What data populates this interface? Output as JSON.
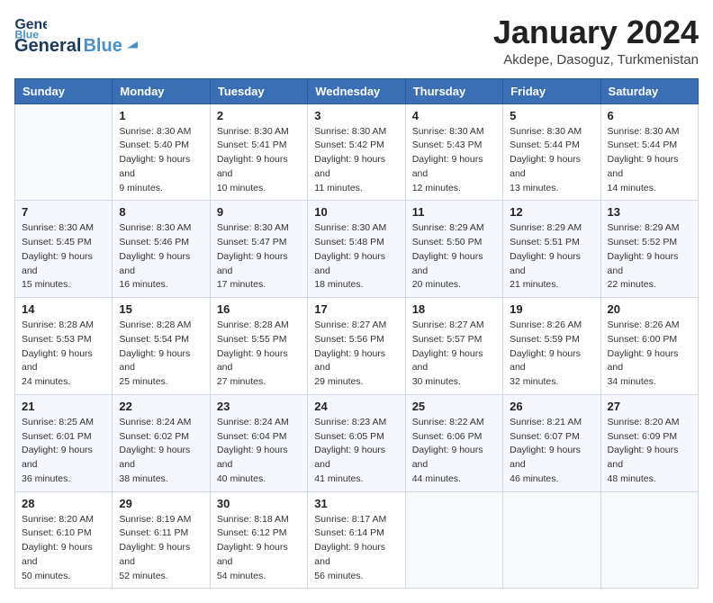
{
  "header": {
    "logo": {
      "general": "General",
      "blue": "Blue"
    },
    "title": "January 2024",
    "location": "Akdepe, Dasoguz, Turkmenistan"
  },
  "days_of_week": [
    "Sunday",
    "Monday",
    "Tuesday",
    "Wednesday",
    "Thursday",
    "Friday",
    "Saturday"
  ],
  "weeks": [
    [
      {
        "day": "",
        "sunrise": "",
        "sunset": "",
        "daylight": ""
      },
      {
        "day": "1",
        "sunrise": "Sunrise: 8:30 AM",
        "sunset": "Sunset: 5:40 PM",
        "daylight": "Daylight: 9 hours and 9 minutes."
      },
      {
        "day": "2",
        "sunrise": "Sunrise: 8:30 AM",
        "sunset": "Sunset: 5:41 PM",
        "daylight": "Daylight: 9 hours and 10 minutes."
      },
      {
        "day": "3",
        "sunrise": "Sunrise: 8:30 AM",
        "sunset": "Sunset: 5:42 PM",
        "daylight": "Daylight: 9 hours and 11 minutes."
      },
      {
        "day": "4",
        "sunrise": "Sunrise: 8:30 AM",
        "sunset": "Sunset: 5:43 PM",
        "daylight": "Daylight: 9 hours and 12 minutes."
      },
      {
        "day": "5",
        "sunrise": "Sunrise: 8:30 AM",
        "sunset": "Sunset: 5:44 PM",
        "daylight": "Daylight: 9 hours and 13 minutes."
      },
      {
        "day": "6",
        "sunrise": "Sunrise: 8:30 AM",
        "sunset": "Sunset: 5:44 PM",
        "daylight": "Daylight: 9 hours and 14 minutes."
      }
    ],
    [
      {
        "day": "7",
        "sunrise": "Sunrise: 8:30 AM",
        "sunset": "Sunset: 5:45 PM",
        "daylight": "Daylight: 9 hours and 15 minutes."
      },
      {
        "day": "8",
        "sunrise": "Sunrise: 8:30 AM",
        "sunset": "Sunset: 5:46 PM",
        "daylight": "Daylight: 9 hours and 16 minutes."
      },
      {
        "day": "9",
        "sunrise": "Sunrise: 8:30 AM",
        "sunset": "Sunset: 5:47 PM",
        "daylight": "Daylight: 9 hours and 17 minutes."
      },
      {
        "day": "10",
        "sunrise": "Sunrise: 8:30 AM",
        "sunset": "Sunset: 5:48 PM",
        "daylight": "Daylight: 9 hours and 18 minutes."
      },
      {
        "day": "11",
        "sunrise": "Sunrise: 8:29 AM",
        "sunset": "Sunset: 5:50 PM",
        "daylight": "Daylight: 9 hours and 20 minutes."
      },
      {
        "day": "12",
        "sunrise": "Sunrise: 8:29 AM",
        "sunset": "Sunset: 5:51 PM",
        "daylight": "Daylight: 9 hours and 21 minutes."
      },
      {
        "day": "13",
        "sunrise": "Sunrise: 8:29 AM",
        "sunset": "Sunset: 5:52 PM",
        "daylight": "Daylight: 9 hours and 22 minutes."
      }
    ],
    [
      {
        "day": "14",
        "sunrise": "Sunrise: 8:28 AM",
        "sunset": "Sunset: 5:53 PM",
        "daylight": "Daylight: 9 hours and 24 minutes."
      },
      {
        "day": "15",
        "sunrise": "Sunrise: 8:28 AM",
        "sunset": "Sunset: 5:54 PM",
        "daylight": "Daylight: 9 hours and 25 minutes."
      },
      {
        "day": "16",
        "sunrise": "Sunrise: 8:28 AM",
        "sunset": "Sunset: 5:55 PM",
        "daylight": "Daylight: 9 hours and 27 minutes."
      },
      {
        "day": "17",
        "sunrise": "Sunrise: 8:27 AM",
        "sunset": "Sunset: 5:56 PM",
        "daylight": "Daylight: 9 hours and 29 minutes."
      },
      {
        "day": "18",
        "sunrise": "Sunrise: 8:27 AM",
        "sunset": "Sunset: 5:57 PM",
        "daylight": "Daylight: 9 hours and 30 minutes."
      },
      {
        "day": "19",
        "sunrise": "Sunrise: 8:26 AM",
        "sunset": "Sunset: 5:59 PM",
        "daylight": "Daylight: 9 hours and 32 minutes."
      },
      {
        "day": "20",
        "sunrise": "Sunrise: 8:26 AM",
        "sunset": "Sunset: 6:00 PM",
        "daylight": "Daylight: 9 hours and 34 minutes."
      }
    ],
    [
      {
        "day": "21",
        "sunrise": "Sunrise: 8:25 AM",
        "sunset": "Sunset: 6:01 PM",
        "daylight": "Daylight: 9 hours and 36 minutes."
      },
      {
        "day": "22",
        "sunrise": "Sunrise: 8:24 AM",
        "sunset": "Sunset: 6:02 PM",
        "daylight": "Daylight: 9 hours and 38 minutes."
      },
      {
        "day": "23",
        "sunrise": "Sunrise: 8:24 AM",
        "sunset": "Sunset: 6:04 PM",
        "daylight": "Daylight: 9 hours and 40 minutes."
      },
      {
        "day": "24",
        "sunrise": "Sunrise: 8:23 AM",
        "sunset": "Sunset: 6:05 PM",
        "daylight": "Daylight: 9 hours and 41 minutes."
      },
      {
        "day": "25",
        "sunrise": "Sunrise: 8:22 AM",
        "sunset": "Sunset: 6:06 PM",
        "daylight": "Daylight: 9 hours and 44 minutes."
      },
      {
        "day": "26",
        "sunrise": "Sunrise: 8:21 AM",
        "sunset": "Sunset: 6:07 PM",
        "daylight": "Daylight: 9 hours and 46 minutes."
      },
      {
        "day": "27",
        "sunrise": "Sunrise: 8:20 AM",
        "sunset": "Sunset: 6:09 PM",
        "daylight": "Daylight: 9 hours and 48 minutes."
      }
    ],
    [
      {
        "day": "28",
        "sunrise": "Sunrise: 8:20 AM",
        "sunset": "Sunset: 6:10 PM",
        "daylight": "Daylight: 9 hours and 50 minutes."
      },
      {
        "day": "29",
        "sunrise": "Sunrise: 8:19 AM",
        "sunset": "Sunset: 6:11 PM",
        "daylight": "Daylight: 9 hours and 52 minutes."
      },
      {
        "day": "30",
        "sunrise": "Sunrise: 8:18 AM",
        "sunset": "Sunset: 6:12 PM",
        "daylight": "Daylight: 9 hours and 54 minutes."
      },
      {
        "day": "31",
        "sunrise": "Sunrise: 8:17 AM",
        "sunset": "Sunset: 6:14 PM",
        "daylight": "Daylight: 9 hours and 56 minutes."
      },
      {
        "day": "",
        "sunrise": "",
        "sunset": "",
        "daylight": ""
      },
      {
        "day": "",
        "sunrise": "",
        "sunset": "",
        "daylight": ""
      },
      {
        "day": "",
        "sunrise": "",
        "sunset": "",
        "daylight": ""
      }
    ]
  ]
}
